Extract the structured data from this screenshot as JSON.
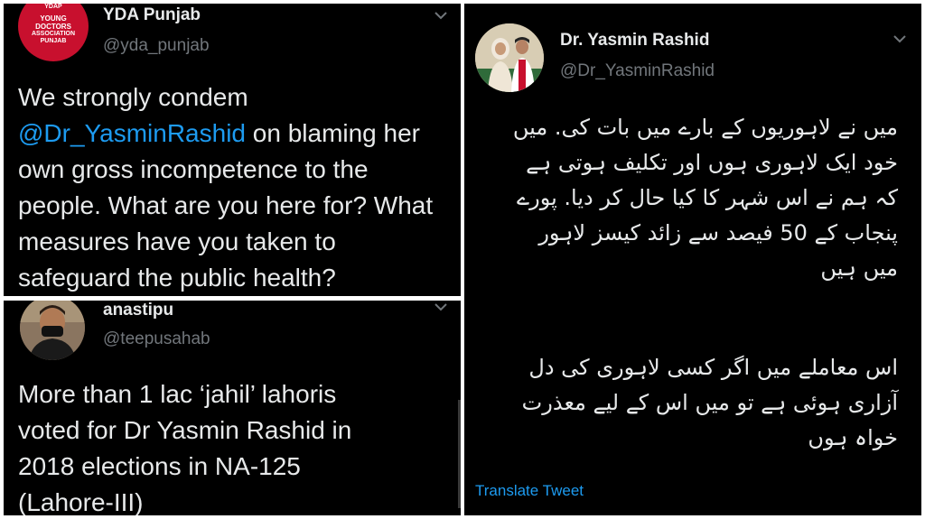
{
  "tweet1": {
    "author_name": "YDA Punjab",
    "author_handle": "@yda_punjab",
    "avatar_text": {
      "top": "YDAP",
      "line1": "YOUNG",
      "line2": "DOCTORS",
      "line3": "ASSOCIATION",
      "line4": "PUNJAB"
    },
    "body_before": "We strongly condem ",
    "mention": "@Dr_YasminRashid",
    "body_after": " on blaming her own gross incompetence to the people. What are you here for? What measures have you taken to safeguard the public health?"
  },
  "tweet2": {
    "author_name": "anastipu",
    "author_handle": "@teepusahab",
    "body": "More than 1 lac ‘jahil’ lahoris voted for Dr Yasmin Rashid in 2018 elections in NA-125 (Lahore-III)"
  },
  "tweet3": {
    "author_name": "Dr. Yasmin Rashid",
    "author_handle": "@Dr_YasminRashid",
    "body_lines_1": [
      "میں نے لاہوریوں کے بارے میں بات کی. میں",
      "خود ایک لاہوری ہوں اور تکلیف ہوتی ہے",
      "کہ ہم نے اس شہر کا کیا حال کر دیا. پورے",
      "پنجاب کے 50 فیصد سے زائد کیسز لاہور",
      "میں ہیں"
    ],
    "body_lines_2": [
      "اس معاملے میں اگر کسی لاہوری کی دل",
      "آزاری ہوئی ہے تو میں اس کے لیے معذرت",
      "خواہ ہوں"
    ],
    "translate_label": "Translate Tweet"
  },
  "colors": {
    "background": "#000000",
    "text": "#e7e9ea",
    "secondary": "#71767b",
    "link": "#1d9bf0",
    "logo_red": "#c8102e"
  },
  "icons": [
    "chevron-down-icon",
    "avatar"
  ]
}
